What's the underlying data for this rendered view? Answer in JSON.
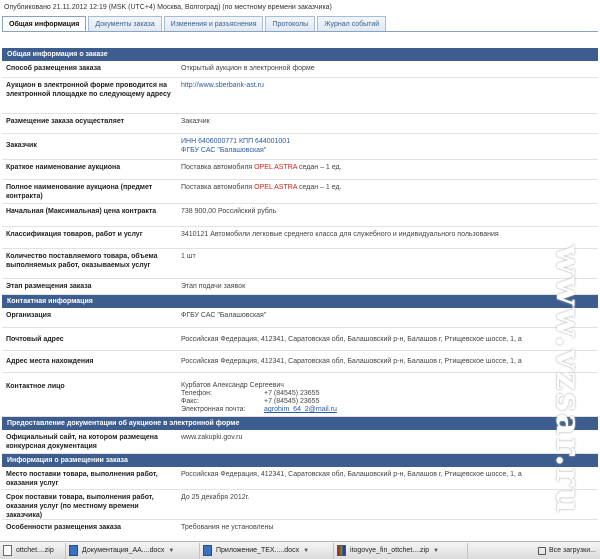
{
  "header": {
    "published": "Опубликовано 21.11.2012 12:19 (MSK (UTC+4) Москва, Волгоград) (по местному времени заказчика)"
  },
  "tabs": [
    {
      "label": "Общая информация",
      "active": true
    },
    {
      "label": "Документы заказа",
      "active": false
    },
    {
      "label": "Изменения и разъяснения",
      "active": false
    },
    {
      "label": "Протоколы",
      "active": false
    },
    {
      "label": "Журнал событий",
      "active": false
    }
  ],
  "sections": {
    "general": {
      "title": "Общая информация о заказе",
      "method_label": "Способ размещения заказа",
      "method_value": "Открытый аукцион в электронной форме",
      "platform_label": "Аукцион в электронной форме проводится на электронной площадке по следующему адресу",
      "platform_value": "http://www.sberbank-ast.ru",
      "placement_label": "Размещение заказа осуществляет",
      "placement_value": "Заказчик",
      "customer_label": "Заказчик",
      "customer_inn": "ИНН 6406000771 КПП 644001001",
      "customer_name": "ФГБУ САС \"Балашовская\"",
      "short_label": "Краткое наименование аукциона",
      "short_prefix": "Поставка автомобиля",
      "short_brand": "OPEL ASTRA",
      "short_suffix": "седан – 1 ед.",
      "full_label": "Полное наименование аукциона (предмет контракта)",
      "full_prefix": "Поставка автомобиля",
      "full_brand": "OPEL ASTRA",
      "full_suffix": "седан – 1 ед.",
      "price_label": "Начальная (Максимальная) цена контракта",
      "price_value": "738 900,00 Российский рубль",
      "class_label": "Классификация товаров, работ и услуг",
      "class_value": "3410121 Автомобили легковые среднего класса для служебного и индивидуального пользования",
      "qty_label": "Количество поставляемого товара, объема выполняемых работ, оказываемых услуг",
      "qty_value": "1 шт",
      "stage_label": "Этап размещения заказа",
      "stage_value": "Этап подачи заявок"
    },
    "contacts": {
      "title": "Контактная информация",
      "org_label": "Организация",
      "org_value": "ФГБУ САС \"Балашовская\"",
      "postal_label": "Почтовый адрес",
      "postal_value": "Российская Федерация, 412341, Саратовская обл, Балашовский р-н, Балашов г, Ртищевское шоссе, 1, а",
      "location_label": "Адрес места нахождения",
      "location_value": "Российская Федерация, 412341, Саратовская обл, Балашовский р-н, Балашов г, Ртищевское шоссе, 1, а",
      "person_label": "Контактное лицо",
      "person_name": "Курбатов Александр Сергеевич",
      "phone_key": "Телефон:",
      "phone_val": "+7 (84545) 23655",
      "fax_key": "Факс:",
      "fax_val": "+7 (84545) 23655",
      "email_key": "Электронная почта:",
      "email_val": "agrohim_64_2@mail.ru"
    },
    "docs": {
      "title": "Предоставление документации об аукционе в электронной форме",
      "site_label": "Официальный сайт, на котором размещена конкурсная документация",
      "site_value": "www.zakupki.gov.ru"
    },
    "info": {
      "title": "Информация о размещении заказа",
      "place_label": "Место поставки товара, выполнения работ, оказания услуг",
      "place_value": "Российская Федерация, 412341, Саратовская обл, Балашовский р-н, Балашов г, Ртищевское шоссе, 1, а",
      "term_label": "Срок поставки товара, выполнения работ, оказания услуг (по местному времени заказчика)",
      "term_value": "До 25 декабря 2012г.",
      "special_label": "Особенности размещения заказа",
      "special_value": "Требования не установлены"
    }
  },
  "watermark": "www.vzsar.ru",
  "downloads": {
    "items": [
      {
        "name": "ottchet....zip",
        "icon": "file-icon"
      },
      {
        "name": "Документация_АА....docx",
        "icon": "word-icon"
      },
      {
        "name": "Приложение_ТЕХ.....docx",
        "icon": "word-icon"
      },
      {
        "name": "itogovye_fin_ottchet....zip",
        "icon": "zip-icon"
      }
    ],
    "all_label": "Все загрузки..."
  }
}
